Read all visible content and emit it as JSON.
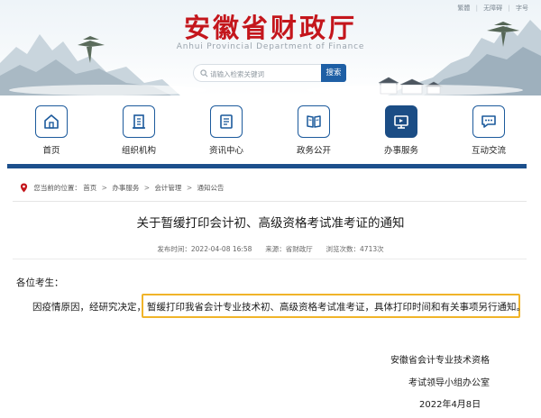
{
  "header": {
    "site_title": "安徽省财政厅",
    "site_subtitle": "Anhui Provincial Department of Finance",
    "top_links": {
      "traditional": "繁體",
      "accessibility": "无障碍",
      "font": "字号"
    },
    "search": {
      "placeholder": "请输入检索关键词",
      "button_label": "搜索"
    }
  },
  "nav": {
    "items": [
      {
        "label": "首页",
        "icon": "home-icon"
      },
      {
        "label": "组织机构",
        "icon": "building-icon"
      },
      {
        "label": "资讯中心",
        "icon": "document-icon"
      },
      {
        "label": "政务公开",
        "icon": "book-icon"
      },
      {
        "label": "办事服务",
        "icon": "monitor-icon",
        "active": true
      },
      {
        "label": "互动交流",
        "icon": "chat-icon"
      }
    ]
  },
  "breadcrumb": {
    "prefix": "您当前的位置：",
    "items": [
      "首页",
      "办事服务",
      "会计管理",
      "通知公告"
    ]
  },
  "article": {
    "title": "关于暂缓打印会计初、高级资格考试准考证的通知",
    "meta": {
      "published": "发布时间：2022-04-08 16:58",
      "source": "来源：省财政厅",
      "views": "浏览次数：4713次"
    },
    "greeting": "各位考生：",
    "para_start": "因疫情原因，经研究决定，",
    "highlighted": "暂缓打印我省会计专业技术初、高级资格考试准考证，具体打印时间和有关事项另行通知。",
    "signature": {
      "line1": "安徽省会计专业技术资格",
      "line2": "考试领导小组办公室",
      "date": "2022年4月8日"
    }
  },
  "colors": {
    "brand_red": "#c4161c",
    "nav_blue": "#1c5a9c",
    "active_bg": "#1b4d85",
    "highlight_border": "#f0b429"
  }
}
